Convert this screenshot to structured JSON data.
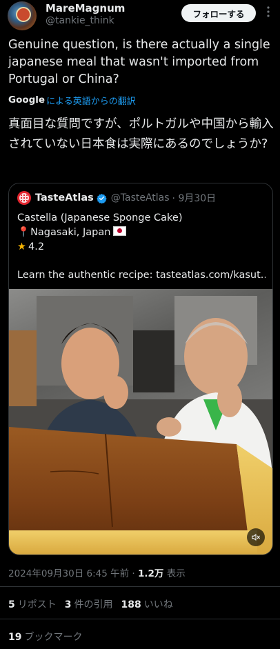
{
  "author": {
    "display_name": "MareMagnum",
    "handle": "@tankie_think",
    "follow_label": "フォローする",
    "more_icon": "more-dots-icon"
  },
  "tweet": {
    "text_en": "Genuine question, is there actually a single japanese meal that wasn't imported from Portugal or China?",
    "translate_provider": "Google",
    "translate_label": "による英語からの翻訳",
    "text_ja": "真面目な質問ですが、ポルトガルや中国から輸入されていない日本食は実際にあるのでしょうか?"
  },
  "quote": {
    "name": "TasteAtlas",
    "handle": "@TasteAtlas",
    "date": "· 9月30日",
    "line1": "Castella (Japanese Sponge Cake)",
    "line2": "Nagasaki, Japan",
    "rating": "4.2",
    "line4": "Learn the authentic recipe: tasteatlas.com/kasut..."
  },
  "meta": {
    "timestamp": "2024年09月30日 6:45 午前 · ",
    "views_count": "1.2万",
    "views_label": " 表示"
  },
  "stats": {
    "reposts_count": "5",
    "reposts_label": "リポスト",
    "quotes_count": "3",
    "quotes_label": "件の引用",
    "likes_count": "188",
    "likes_label": "いいね",
    "bookmarks_count": "19",
    "bookmarks_label": "ブックマーク"
  },
  "colors": {
    "background": "#000000",
    "text": "#e7e9ea",
    "secondary_text": "#71767b",
    "link": "#1d9bf0",
    "border": "#2f3336",
    "verified": "#1d9bf0"
  }
}
